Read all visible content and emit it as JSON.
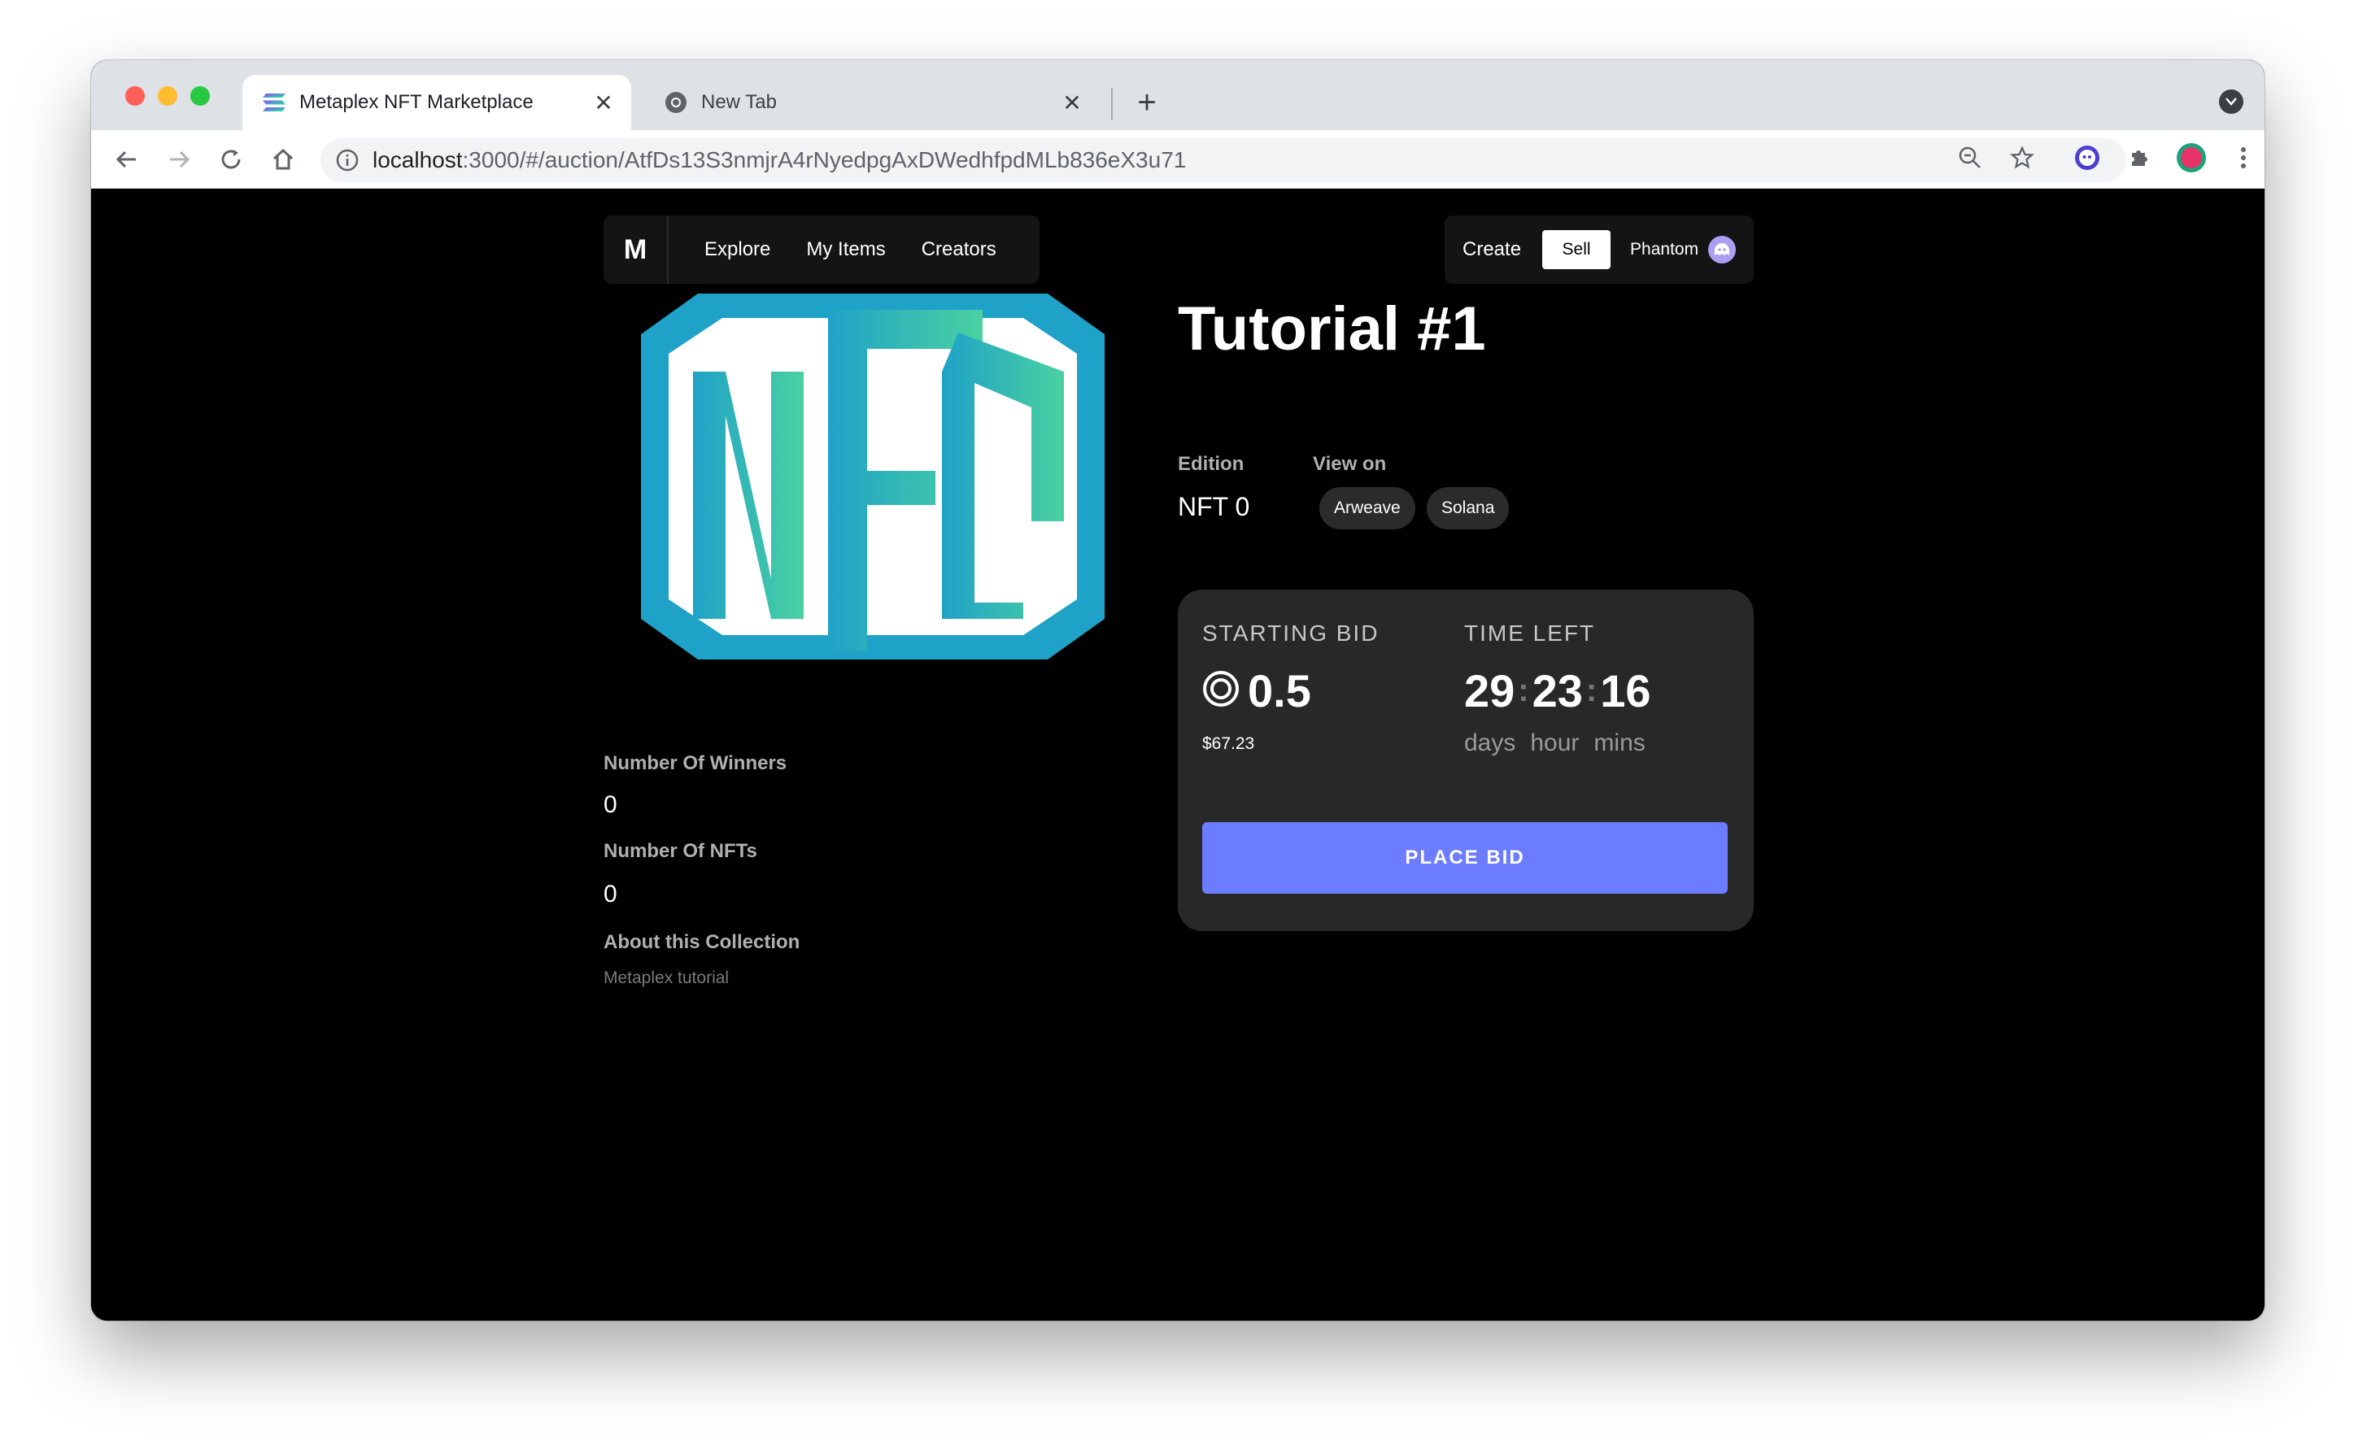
{
  "browser": {
    "tabs": [
      {
        "title": "Metaplex NFT Marketplace",
        "active": true
      },
      {
        "title": "New Tab",
        "active": false
      }
    ],
    "new_tab_symbol": "+",
    "close_symbol": "✕",
    "url_host": "localhost",
    "url_rest": ":3000/#/auction/AtfDs13S3nmjrA4rNyedpgAxDWedhfpdMLb836eX3u71"
  },
  "nav": {
    "logo": "M",
    "links": [
      "Explore",
      "My Items",
      "Creators"
    ],
    "create_label": "Create",
    "sell_label": "Sell",
    "wallet_label": "Phantom"
  },
  "artwork": {
    "text": "NFT",
    "colors": {
      "frame": "#1fa2c8",
      "gradient_start": "#1fa2c8",
      "gradient_end": "#4ad1a0"
    }
  },
  "details": {
    "winners_label": "Number Of Winners",
    "winners_value": "0",
    "nfts_label": "Number Of NFTs",
    "nfts_value": "0",
    "about_label": "About this Collection",
    "about_text": "Metaplex tutorial"
  },
  "item": {
    "title": "Tutorial #1",
    "edition_label": "Edition",
    "edition_value": "NFT 0",
    "view_on_label": "View on",
    "view_on_links": [
      "Arweave",
      "Solana"
    ]
  },
  "auction": {
    "starting_bid_label": "STARTING BID",
    "bid_amount": "0.5",
    "bid_usd": "$67.23",
    "time_left_label": "TIME LEFT",
    "time": {
      "days": "29",
      "hours": "23",
      "mins": "16"
    },
    "units": {
      "days": "days",
      "hours": "hour",
      "mins": "mins"
    },
    "place_bid_label": "PLACE BID"
  }
}
